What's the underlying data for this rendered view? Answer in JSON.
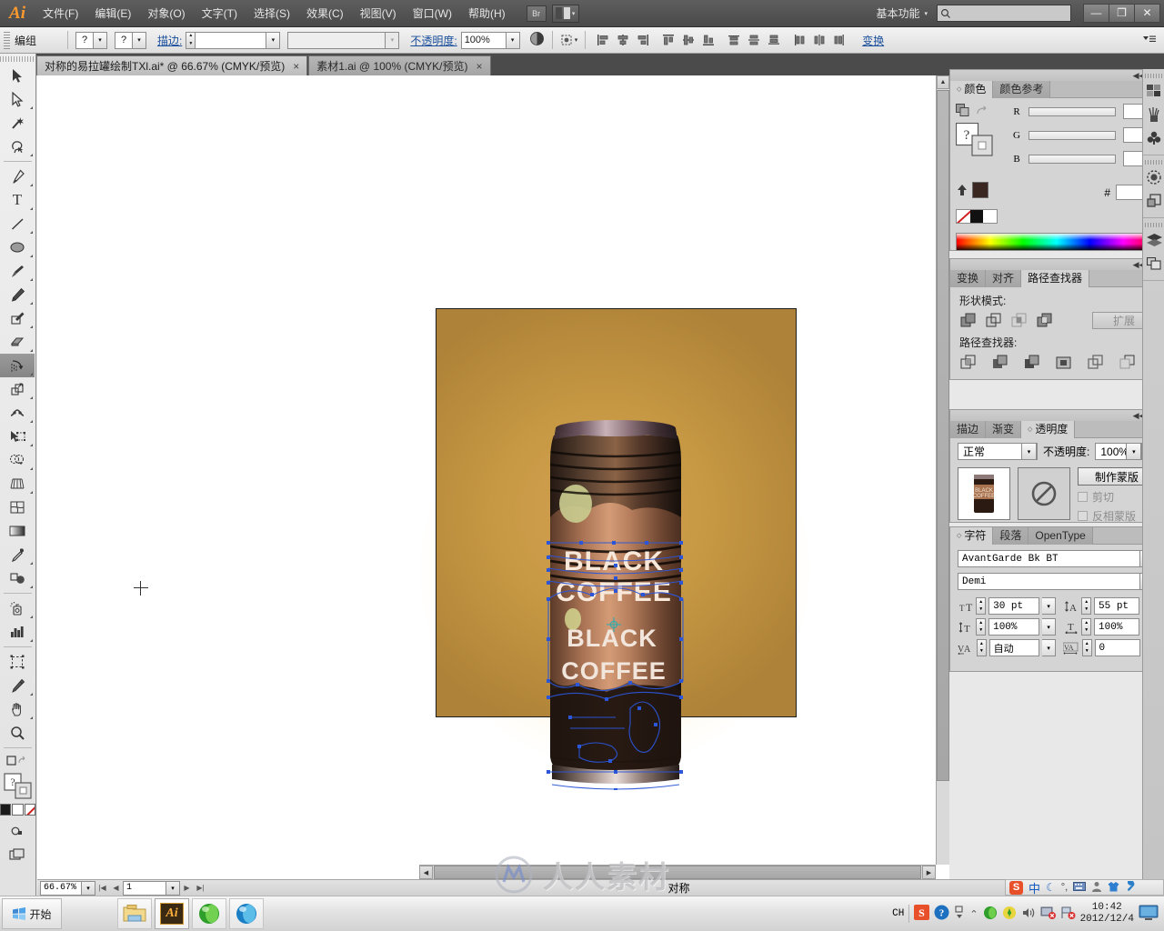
{
  "app": {
    "logo": "Ai",
    "menus": [
      {
        "label": "文件(F)"
      },
      {
        "label": "编辑(E)"
      },
      {
        "label": "对象(O)"
      },
      {
        "label": "文字(T)"
      },
      {
        "label": "选择(S)"
      },
      {
        "label": "效果(C)"
      },
      {
        "label": "视图(V)"
      },
      {
        "label": "窗口(W)"
      },
      {
        "label": "帮助(H)"
      }
    ],
    "bridge_label": "Br",
    "workspace": "基本功能",
    "search_placeholder": "",
    "window_buttons": {
      "minimize": "—",
      "restore": "❐",
      "close": "✕"
    }
  },
  "control_bar": {
    "selection_label": "编组",
    "fill_label": "?",
    "stroke_swatch_label": "?",
    "stroke_label": "描边:",
    "stroke_weight": "",
    "stroke_profile": "",
    "opacity_label": "不透明度:",
    "opacity_value": "100%",
    "transform_link": "变换",
    "align_icons": [
      "align-left-icon",
      "align-center-h-icon",
      "align-right-icon",
      "align-top-icon",
      "align-middle-v-icon",
      "align-bottom-icon",
      "distribute-top-icon",
      "distribute-center-v-icon",
      "distribute-bottom-icon",
      "distribute-left-icon",
      "distribute-center-h-icon",
      "distribute-right-icon"
    ]
  },
  "tabs": [
    {
      "title": "对称的易拉罐绘制TXl.ai* @ 66.67% (CMYK/预览)",
      "active": true,
      "close": "×"
    },
    {
      "title": "素材1.ai @ 100% (CMYK/预览)",
      "active": false,
      "close": "×"
    }
  ],
  "toolbox": {
    "tools": [
      {
        "name": "selection-tool",
        "glyph": "⬆"
      },
      {
        "name": "direct-selection-tool",
        "glyph": "⬆"
      },
      {
        "name": "magic-wand-tool",
        "glyph": "✳"
      },
      {
        "name": "lasso-tool",
        "glyph": "☁"
      },
      {
        "name": "pen-tool",
        "glyph": "✒"
      },
      {
        "name": "type-tool",
        "glyph": "T"
      },
      {
        "name": "line-segment-tool",
        "glyph": "╱"
      },
      {
        "name": "ellipse-tool",
        "glyph": "⬭"
      },
      {
        "name": "paintbrush-tool",
        "glyph": "὘C"
      },
      {
        "name": "pencil-tool",
        "glyph": "✎"
      },
      {
        "name": "blob-brush-tool",
        "glyph": "✐"
      },
      {
        "name": "eraser-tool",
        "glyph": "▱"
      },
      {
        "name": "rotate-reflect-tool",
        "glyph": "↻",
        "active": true
      },
      {
        "name": "scale-tool",
        "glyph": "◰"
      },
      {
        "name": "width-warp-tool",
        "glyph": "∿"
      },
      {
        "name": "free-transform-tool",
        "glyph": "❖"
      },
      {
        "name": "shape-builder-tool",
        "glyph": "◌"
      },
      {
        "name": "perspective-grid-tool",
        "glyph": "▦"
      },
      {
        "name": "mesh-tool",
        "glyph": "⌧"
      },
      {
        "name": "gradient-tool",
        "glyph": "▤"
      },
      {
        "name": "eyedropper-tool",
        "glyph": "⚗"
      },
      {
        "name": "blend-tool",
        "glyph": "◑"
      },
      {
        "name": "symbol-sprayer-tool",
        "glyph": "⁂"
      },
      {
        "name": "column-graph-tool",
        "glyph": "█"
      },
      {
        "name": "artboard-tool",
        "glyph": "⬚"
      },
      {
        "name": "slice-tool",
        "glyph": "✂"
      },
      {
        "name": "hand-tool",
        "glyph": "✋"
      },
      {
        "name": "zoom-tool",
        "glyph": "ὐD"
      }
    ]
  },
  "color_panel": {
    "tabs": [
      {
        "label": "颜色",
        "active": true
      },
      {
        "label": "颜色参考",
        "active": false
      }
    ],
    "channels": [
      {
        "label": "R",
        "value": ""
      },
      {
        "label": "G",
        "value": ""
      },
      {
        "label": "B",
        "value": ""
      }
    ],
    "hex_label": "#",
    "hex_value": "",
    "fill_color": "#3a2620"
  },
  "pathfinder_panel": {
    "tabs": [
      {
        "label": "变换",
        "active": false
      },
      {
        "label": "对齐",
        "active": false
      },
      {
        "label": "路径查找器",
        "active": true
      }
    ],
    "shape_modes_label": "形状模式:",
    "shape_mode_icons": [
      "unite-icon",
      "minus-front-icon",
      "intersect-icon",
      "exclude-icon"
    ],
    "expand_label": "扩展",
    "pathfinders_label": "路径查找器:",
    "pathfinder_icons": [
      "divide-icon",
      "trim-icon",
      "merge-icon",
      "crop-icon",
      "outline-icon",
      "minus-back-icon"
    ]
  },
  "transparency_panel": {
    "tabs": [
      {
        "label": "描边",
        "active": false
      },
      {
        "label": "渐变",
        "active": false
      },
      {
        "label": "透明度",
        "active": true
      }
    ],
    "blend_mode": "正常",
    "opacity_label": "不透明度:",
    "opacity_value": "100%",
    "make_mask_label": "制作蒙版",
    "clip_label": "剪切",
    "invert_mask_label": "反相蒙版"
  },
  "character_panel": {
    "tabs": [
      {
        "label": "字符",
        "active": true
      },
      {
        "label": "段落",
        "active": false
      },
      {
        "label": "OpenType",
        "active": false
      }
    ],
    "font_family": "AvantGarde Bk BT",
    "font_style": "Demi",
    "font_size": "30 pt",
    "leading": "55 pt",
    "vertical_scale": "100%",
    "horizontal_scale": "100%",
    "kerning": "自动",
    "tracking": "0"
  },
  "icon_dock": [
    {
      "name": "swatches-icon"
    },
    {
      "name": "brushes-icon"
    },
    {
      "name": "symbols-icon"
    },
    {
      "name": "stroke-icon"
    },
    {
      "name": "graphic-styles-icon"
    },
    {
      "name": "layers-icon"
    },
    {
      "name": "artboards-icon"
    }
  ],
  "canvas": {
    "artwork_title": "BLACK COFFEE",
    "can_label_line1": "BLACK",
    "can_label_line2": "COFFEE",
    "artboard_bg": "#c79944"
  },
  "status_bar": {
    "zoom_level": "66.67%",
    "page_number": "1",
    "status_text": "对称"
  },
  "ime_bar": {
    "logo": "S",
    "mode": "中",
    "icons": [
      "moon-icon",
      "punctuation-icon",
      "keyboard-icon",
      "user-icon",
      "skin-icon",
      "wrench-icon"
    ]
  },
  "watermark": {
    "text": "人人素材"
  },
  "taskbar": {
    "start_label": "开始",
    "apps": [
      {
        "name": "explorer",
        "glyph": "📁",
        "active": false
      },
      {
        "name": "illustrator",
        "glyph": "Ai",
        "active": true
      },
      {
        "name": "browser-green",
        "glyph": "●",
        "active": false
      },
      {
        "name": "browser-blue",
        "glyph": "●",
        "active": false
      }
    ],
    "tray": {
      "language": "CH",
      "time": "10:42",
      "date": "2012/12/4"
    }
  }
}
